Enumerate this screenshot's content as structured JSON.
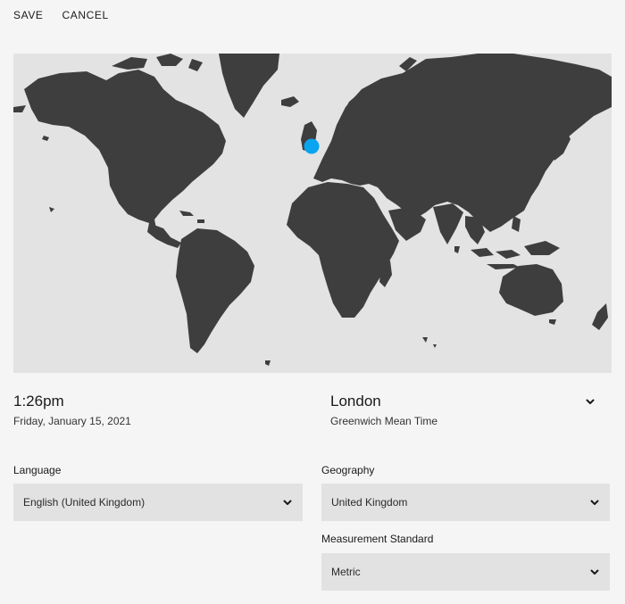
{
  "toolbar": {
    "save_label": "SAVE",
    "cancel_label": "CANCEL"
  },
  "map": {
    "marker_location": "London",
    "marker_color": "#0aa4f0",
    "land_color": "#3e3e3e",
    "water_color": "#e3e3e3"
  },
  "clock": {
    "time": "1:26pm",
    "date": "Friday, January 15, 2021"
  },
  "timezone": {
    "city": "London",
    "name": "Greenwich Mean Time",
    "icon": "chevron-down-icon"
  },
  "language": {
    "label": "Language",
    "value": "English (United Kingdom)",
    "icon": "chevron-down-icon"
  },
  "geography": {
    "label": "Geography",
    "value": "United Kingdom",
    "icon": "chevron-down-icon"
  },
  "measurement": {
    "label": "Measurement Standard",
    "value": "Metric",
    "icon": "chevron-down-icon"
  }
}
